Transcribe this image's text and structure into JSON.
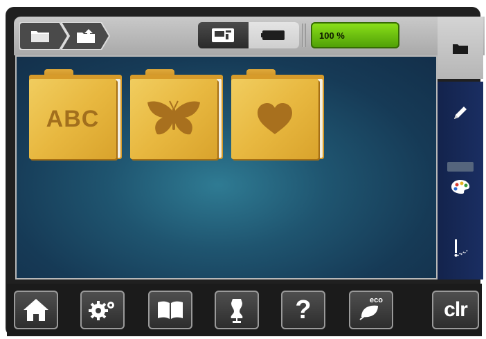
{
  "header": {
    "breadcrumb": [
      {
        "icon": "folder-icon"
      },
      {
        "icon": "folder-open-icon"
      }
    ],
    "view_toggle": [
      {
        "icon": "machine-icon",
        "active": true
      },
      {
        "icon": "presser-foot-icon",
        "active": false
      }
    ],
    "zoom_label": "100 %"
  },
  "folders": [
    {
      "icon": "abc-folder-icon",
      "label": "ABC"
    },
    {
      "icon": "butterfly-folder-icon",
      "label": ""
    },
    {
      "icon": "heart-folder-icon",
      "label": ""
    }
  ],
  "sidebar": {
    "tabs": [
      {
        "icon": "folder-icon",
        "active": true
      },
      {
        "icon": "pencil-icon"
      },
      {
        "icon": "palette-icon"
      },
      {
        "icon": "needle-icon"
      }
    ]
  },
  "toolbar": {
    "buttons": [
      {
        "icon": "home-icon"
      },
      {
        "icon": "settings-icon"
      },
      {
        "icon": "book-icon"
      },
      {
        "icon": "dress-form-icon"
      },
      {
        "icon": "help-icon",
        "label": "?"
      },
      {
        "icon": "eco-leaf-icon",
        "label": "eco"
      },
      {
        "icon": "clear-icon",
        "label": "clr"
      }
    ]
  },
  "colors": {
    "accent_green": "#6cc20f",
    "folder_gold": "#e8b840",
    "panel_blue": "#1f5570"
  }
}
